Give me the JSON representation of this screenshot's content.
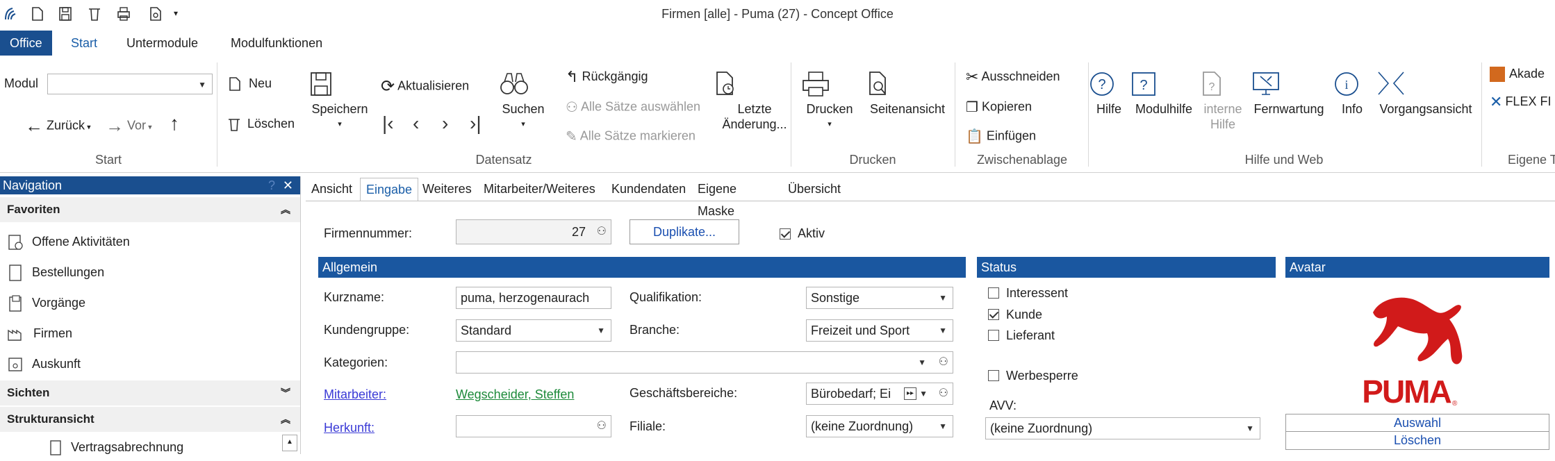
{
  "window": {
    "title": "Firmen [alle] - Puma (27) - Concept Office"
  },
  "ribbon_tabs": [
    "Office",
    "Start",
    "Untermodule",
    "Modulfunktionen"
  ],
  "ribbon": {
    "start": {
      "modul_label": "Modul",
      "back": "Zurück",
      "forward": "Vor",
      "group": "Start"
    },
    "datensatz": {
      "neu": "Neu",
      "loeschen": "Löschen",
      "speichern": "Speichern",
      "aktualisieren": "Aktualisieren",
      "suchen": "Suchen",
      "rueckgaengig": "Rückgängig",
      "alle_auswaehlen": "Alle Sätze auswählen",
      "alle_markieren": "Alle Sätze markieren",
      "letzte_1": "Letzte",
      "letzte_2": "Änderung...",
      "group": "Datensatz"
    },
    "drucken": {
      "drucken": "Drucken",
      "seitenansicht": "Seitenansicht",
      "group": "Drucken"
    },
    "zwischenablage": {
      "ausschneiden": "Ausschneiden",
      "kopieren": "Kopieren",
      "einfuegen": "Einfügen",
      "group": "Zwischenablage"
    },
    "hilfe": {
      "hilfe": "Hilfe",
      "modulhilfe": "Modulhilfe",
      "interne_1": "interne",
      "interne_2": "Hilfe",
      "fernwartung": "Fernwartung",
      "info": "Info",
      "vorgangsansicht": "Vorgangsansicht",
      "group": "Hilfe und Web"
    },
    "eigene": {
      "akadem": "Akade",
      "flex": "FLEX FI",
      "group": "Eigene T"
    }
  },
  "navigation": {
    "title": "Navigation",
    "favoriten_label": "Favoriten",
    "favoriten": [
      "Offene Aktivitäten",
      "Bestellungen",
      "Vorgänge",
      "Firmen",
      "Auskunft"
    ],
    "sichten_label": "Sichten",
    "struktur_label": "Strukturansicht",
    "struktur_items": [
      "Vertragsabrechnung"
    ]
  },
  "form_tabs": [
    "Ansicht",
    "Eingabe",
    "Weiteres",
    "Mitarbeiter/Weiteres",
    "Kundendaten",
    "Eigene Maske",
    "Übersicht"
  ],
  "form": {
    "firmennummer_label": "Firmennummer:",
    "firmennummer": "27",
    "duplikate": "Duplikate...",
    "aktiv_label": "Aktiv",
    "allgemein_title": "Allgemein",
    "kurzname_label": "Kurzname:",
    "kurzname": "puma, herzogenaurach",
    "qualifikation_label": "Qualifikation:",
    "qualifikation": "Sonstige",
    "kundengruppe_label": "Kundengruppe:",
    "kundengruppe": "Standard",
    "branche_label": "Branche:",
    "branche": "Freizeit und Sport",
    "kategorien_label": "Kategorien:",
    "mitarbeiter_label": "Mitarbeiter:",
    "mitarbeiter": "Wegscheider, Steffen",
    "geschaeftsbereiche_label": "Geschäftsbereiche:",
    "geschaeftsbereiche": "Bürobedarf; Ei",
    "herkunft_label": "Herkunft:",
    "filiale_label": "Filiale:",
    "filiale": "(keine Zuordnung)"
  },
  "status": {
    "title": "Status",
    "interessent": "Interessent",
    "kunde": "Kunde",
    "lieferant": "Lieferant",
    "werbesperre": "Werbesperre",
    "avv_label": "AVV:",
    "avv": "(keine Zuordnung)"
  },
  "avatar": {
    "title": "Avatar",
    "logo_text": "PUMA",
    "auswahl": "Auswahl",
    "loeschen": "Löschen"
  }
}
